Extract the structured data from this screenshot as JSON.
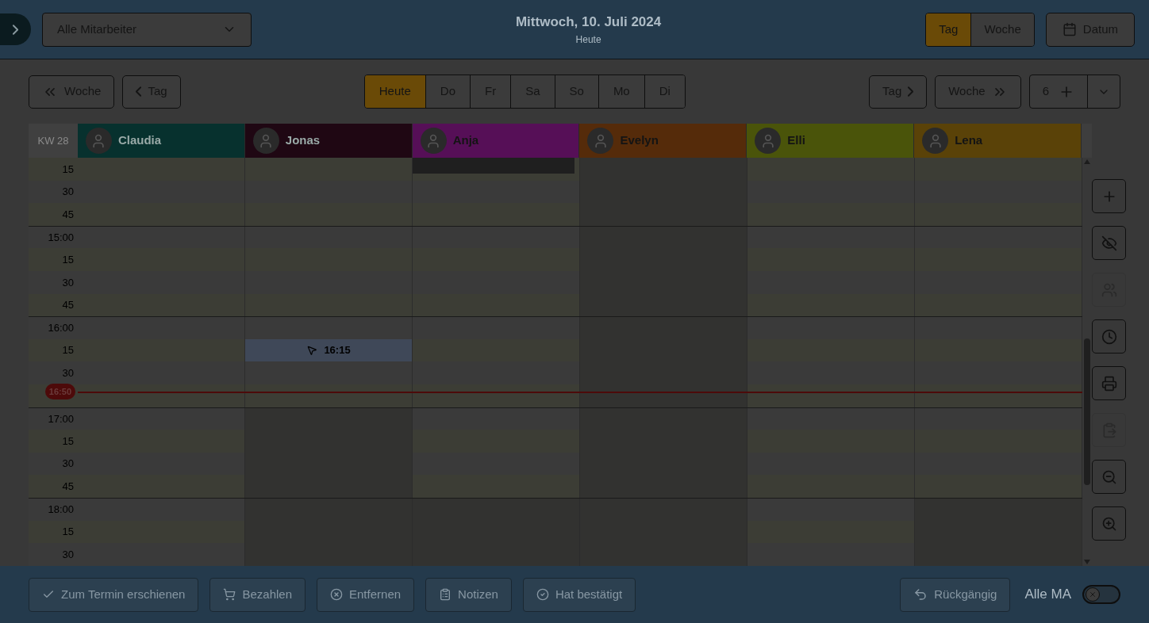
{
  "top_bar": {
    "staff_select": "Alle Mitarbeiter",
    "title": "Mittwoch, 10. Juli 2024",
    "subtitle": "Heute",
    "view_tabs": [
      {
        "label": "Tag",
        "selected": true
      },
      {
        "label": "Woche",
        "selected": false
      }
    ],
    "date_button": "Datum"
  },
  "nav": {
    "back_week": "Woche",
    "back_day": "Tag",
    "days": [
      {
        "label": "Heute",
        "selected": true
      },
      {
        "label": "Do",
        "selected": false
      },
      {
        "label": "Fr",
        "selected": false
      },
      {
        "label": "Sa",
        "selected": false
      },
      {
        "label": "So",
        "selected": false
      },
      {
        "label": "Mo",
        "selected": false
      },
      {
        "label": "Di",
        "selected": false
      }
    ],
    "next_day": "Tag",
    "next_week": "Woche",
    "count": "6"
  },
  "calendar": {
    "week": "KW 28",
    "staff": [
      {
        "name": "Claudia",
        "color": "#07312e"
      },
      {
        "name": "Jonas",
        "color": "#1f0713"
      },
      {
        "name": "Anja",
        "color": "#560f57"
      },
      {
        "name": "Evelyn",
        "color": "#552b0a"
      },
      {
        "name": "Elli",
        "color": "#4a540a"
      },
      {
        "name": "Lena",
        "color": "#5a4208"
      }
    ],
    "rows": [
      {
        "label": "15",
        "hour": false,
        "cells": [
          {
            "kind": "free"
          },
          {
            "kind": "free"
          },
          {
            "kind": "event"
          },
          {
            "kind": "blocked"
          },
          {
            "kind": "free"
          },
          {
            "kind": "free"
          }
        ]
      },
      {
        "label": "30",
        "hour": false,
        "cells": [
          {
            "kind": "free"
          },
          {
            "kind": "free"
          },
          {
            "kind": "free"
          },
          {
            "kind": "blocked"
          },
          {
            "kind": "free"
          },
          {
            "kind": "free"
          }
        ]
      },
      {
        "label": "45",
        "hour": false,
        "cells": [
          {
            "kind": "free"
          },
          {
            "kind": "free"
          },
          {
            "kind": "free"
          },
          {
            "kind": "blocked"
          },
          {
            "kind": "free"
          },
          {
            "kind": "free"
          }
        ]
      },
      {
        "label": "15:00",
        "hour": true,
        "cells": [
          {
            "kind": "free"
          },
          {
            "kind": "free"
          },
          {
            "kind": "free"
          },
          {
            "kind": "blocked"
          },
          {
            "kind": "free"
          },
          {
            "kind": "free"
          }
        ]
      },
      {
        "label": "15",
        "hour": false,
        "cells": [
          {
            "kind": "free"
          },
          {
            "kind": "free"
          },
          {
            "kind": "free"
          },
          {
            "kind": "blocked"
          },
          {
            "kind": "free"
          },
          {
            "kind": "free"
          }
        ]
      },
      {
        "label": "30",
        "hour": false,
        "cells": [
          {
            "kind": "free"
          },
          {
            "kind": "free"
          },
          {
            "kind": "free"
          },
          {
            "kind": "blocked"
          },
          {
            "kind": "free"
          },
          {
            "kind": "free"
          }
        ]
      },
      {
        "label": "45",
        "hour": false,
        "cells": [
          {
            "kind": "free"
          },
          {
            "kind": "free"
          },
          {
            "kind": "free"
          },
          {
            "kind": "blocked"
          },
          {
            "kind": "free"
          },
          {
            "kind": "free"
          }
        ]
      },
      {
        "label": "16:00",
        "hour": true,
        "cells": [
          {
            "kind": "free"
          },
          {
            "kind": "free"
          },
          {
            "kind": "free"
          },
          {
            "kind": "blocked"
          },
          {
            "kind": "free"
          },
          {
            "kind": "free"
          }
        ]
      },
      {
        "label": "15",
        "hour": false,
        "cells": [
          {
            "kind": "free"
          },
          {
            "kind": "hover",
            "label": "16:15"
          },
          {
            "kind": "free"
          },
          {
            "kind": "blocked"
          },
          {
            "kind": "free"
          },
          {
            "kind": "free"
          }
        ]
      },
      {
        "label": "30",
        "hour": false,
        "cells": [
          {
            "kind": "free"
          },
          {
            "kind": "free"
          },
          {
            "kind": "free"
          },
          {
            "kind": "blocked"
          },
          {
            "kind": "free"
          },
          {
            "kind": "free"
          }
        ]
      },
      {
        "now": "16:50",
        "hour": false,
        "cells": [
          {
            "kind": "free"
          },
          {
            "kind": "free"
          },
          {
            "kind": "free"
          },
          {
            "kind": "blocked"
          },
          {
            "kind": "free"
          },
          {
            "kind": "free"
          }
        ]
      },
      {
        "label": "17:00",
        "hour": true,
        "cells": [
          {
            "kind": "free"
          },
          {
            "kind": "blocked"
          },
          {
            "kind": "free"
          },
          {
            "kind": "blocked"
          },
          {
            "kind": "free"
          },
          {
            "kind": "free"
          }
        ]
      },
      {
        "label": "15",
        "hour": false,
        "cells": [
          {
            "kind": "free"
          },
          {
            "kind": "blocked"
          },
          {
            "kind": "free"
          },
          {
            "kind": "blocked"
          },
          {
            "kind": "free"
          },
          {
            "kind": "free"
          }
        ]
      },
      {
        "label": "30",
        "hour": false,
        "cells": [
          {
            "kind": "free"
          },
          {
            "kind": "blocked"
          },
          {
            "kind": "free"
          },
          {
            "kind": "blocked"
          },
          {
            "kind": "free"
          },
          {
            "kind": "free"
          }
        ]
      },
      {
        "label": "45",
        "hour": false,
        "cells": [
          {
            "kind": "free"
          },
          {
            "kind": "blocked"
          },
          {
            "kind": "free"
          },
          {
            "kind": "blocked"
          },
          {
            "kind": "free"
          },
          {
            "kind": "free"
          }
        ]
      },
      {
        "label": "18:00",
        "hour": true,
        "cells": [
          {
            "kind": "free"
          },
          {
            "kind": "blocked"
          },
          {
            "kind": "blocked"
          },
          {
            "kind": "blocked"
          },
          {
            "kind": "free"
          },
          {
            "kind": "blocked"
          }
        ]
      },
      {
        "label": "15",
        "hour": false,
        "cells": [
          {
            "kind": "free"
          },
          {
            "kind": "blocked"
          },
          {
            "kind": "blocked"
          },
          {
            "kind": "blocked"
          },
          {
            "kind": "free"
          },
          {
            "kind": "blocked"
          }
        ]
      },
      {
        "label": "30",
        "hour": false,
        "cells": [
          {
            "kind": "free"
          },
          {
            "kind": "blocked"
          },
          {
            "kind": "blocked"
          },
          {
            "kind": "blocked"
          },
          {
            "kind": "free"
          },
          {
            "kind": "blocked"
          }
        ]
      }
    ]
  },
  "side_tools": [
    {
      "disabled": false
    },
    {
      "disabled": false
    },
    {
      "disabled": true
    },
    {
      "disabled": false
    },
    {
      "disabled": false
    },
    {
      "disabled": true
    },
    {
      "disabled": false
    },
    {
      "disabled": false
    }
  ],
  "bottom_bar": {
    "actions": [
      {
        "label": "Zum Termin erschienen",
        "disabled": true
      },
      {
        "label": "Bezahlen",
        "disabled": true
      },
      {
        "label": "Entfernen",
        "disabled": true
      },
      {
        "label": "Notizen",
        "disabled": true
      },
      {
        "label": "Hat bestätigt",
        "disabled": true
      }
    ],
    "undo": {
      "label": "Rückgängig",
      "disabled": true
    },
    "all_staff": {
      "label": "Alle MA",
      "on": false
    }
  }
}
